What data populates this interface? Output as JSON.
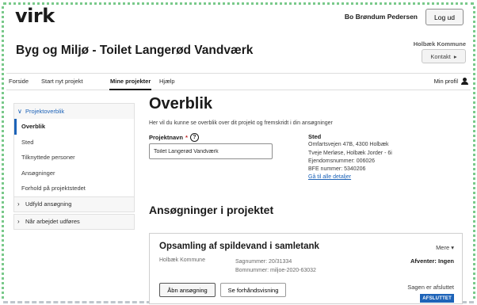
{
  "header": {
    "logo": "virk",
    "user_name": "Bo Brøndum Pedersen",
    "logout_label": "Log ud",
    "page_title": "Byg og Miljø - Toilet Langerød Vandværk",
    "org_name": "Holbæk Kommune",
    "contact_label": "Kontakt",
    "contact_chevron": "▸"
  },
  "nav": {
    "items": [
      {
        "label": "Forside"
      },
      {
        "label": "Start nyt projekt"
      },
      {
        "label": "Mine projekter",
        "active": true
      },
      {
        "label": "Hjælp"
      }
    ],
    "profile_label": "Min profil"
  },
  "sidebar": {
    "group_open": {
      "chevron": "∨",
      "label": "Projektoverblik"
    },
    "items": [
      {
        "label": "Overblik",
        "active": true
      },
      {
        "label": "Sted"
      },
      {
        "label": "Tilknyttede personer"
      },
      {
        "label": "Ansøgninger"
      },
      {
        "label": "Forhold på projektstedet"
      }
    ],
    "groups_closed": [
      {
        "chevron": "›",
        "label": "Udfyld ansøgning"
      },
      {
        "chevron": "›",
        "label": "Når arbejdet udføres"
      }
    ]
  },
  "main": {
    "title": "Overblik",
    "intro": "Her vil du kunne se overblik over dit projekt og fremskridt i din ansøgninger",
    "project_name_label": "Projektnavn",
    "required_mark": "*",
    "help_glyph": "?",
    "project_name_value": "Toilet Langerød Vandværk",
    "sted": {
      "title": "Sted",
      "address": "Omfartsvejen 47B, 4300 Holbæk",
      "locality": "Tveje Merløse, Holbæk Jorder - 6i",
      "property_number": "Ejendomsnummer: 006026",
      "bfe_number": "BFE nummer: 5340206",
      "details_link": "Gå til alle detaljer"
    },
    "applications_heading": "Ansøgninger i projektet"
  },
  "application_card": {
    "title": "Opsamling af spildevand i samletank",
    "more_label": "Mere ▾",
    "org": "Holbæk Kommune",
    "case_number": "Sagnummer:  20/31334",
    "bom_number": "Bomnummer: miljoe-2020-63032",
    "awaits": "Afventer: Ingen",
    "open_label": "Åbn ansøgning",
    "preview_label": "Se forhåndsvisning",
    "status_text": "Sagen er afsluttet",
    "status_badge": "AFSLUTTET",
    "colors": {
      "accent": "#1d63b8",
      "frame_dots": "#79c98a"
    }
  }
}
